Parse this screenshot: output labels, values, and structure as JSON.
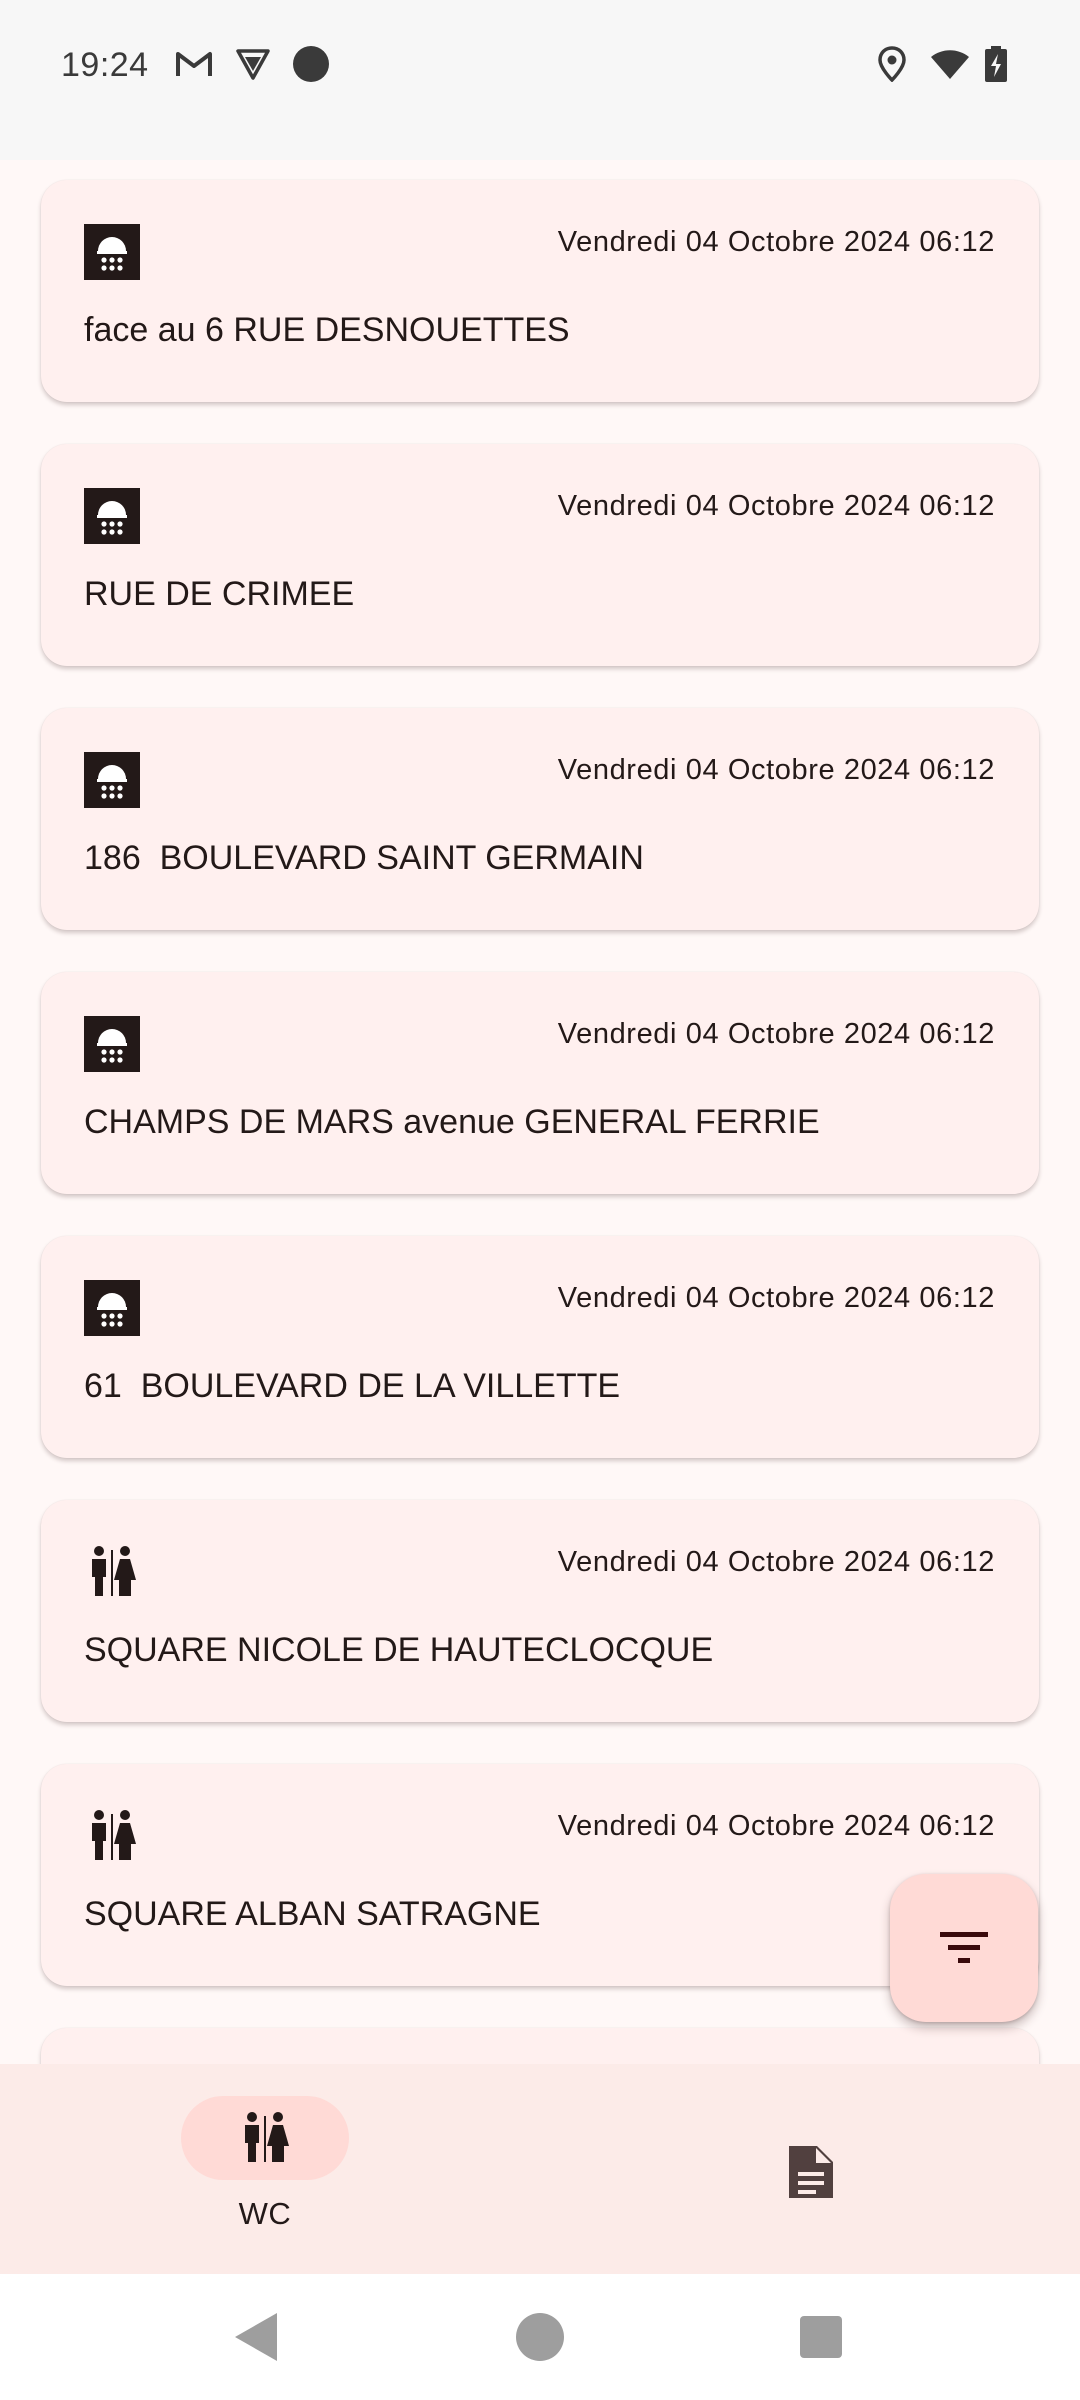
{
  "status_bar": {
    "time": "19:24",
    "left_icons": [
      "gmail-icon",
      "vpn-shield-icon",
      "record-dot-icon"
    ],
    "right_icons": [
      "location-icon",
      "wifi-icon",
      "battery-charging-icon"
    ]
  },
  "list": {
    "items": [
      {
        "type": "shower",
        "icon": "shower-icon",
        "date": "Vendredi 04 Octobre 2024 06:12",
        "address": "face au 6 RUE DESNOUETTES"
      },
      {
        "type": "shower",
        "icon": "shower-icon",
        "date": "Vendredi 04 Octobre 2024 06:12",
        "address": "RUE DE CRIMEE"
      },
      {
        "type": "shower",
        "icon": "shower-icon",
        "date": "Vendredi 04 Octobre 2024 06:12",
        "address": "186  BOULEVARD SAINT GERMAIN"
      },
      {
        "type": "shower",
        "icon": "shower-icon",
        "date": "Vendredi 04 Octobre 2024 06:12",
        "address": "CHAMPS DE MARS avenue GENERAL FERRIE"
      },
      {
        "type": "shower",
        "icon": "shower-icon",
        "date": "Vendredi 04 Octobre 2024 06:12",
        "address": "61  BOULEVARD DE LA VILLETTE"
      },
      {
        "type": "wc",
        "icon": "wc-icon",
        "date": "Vendredi 04 Octobre 2024 06:12",
        "address": "SQUARE NICOLE DE HAUTECLOCQUE"
      },
      {
        "type": "wc",
        "icon": "wc-icon",
        "date": "Vendredi 04 Octobre 2024 06:12",
        "address": "SQUARE ALBAN SATRAGNE"
      },
      {
        "type": "partial",
        "icon": "",
        "date": "",
        "address": ""
      }
    ]
  },
  "fab": {
    "icon": "filter-icon"
  },
  "bottom_nav": {
    "items": [
      {
        "label": "WC",
        "icon": "wc-icon",
        "selected": true
      },
      {
        "label": "",
        "icon": "document-icon",
        "selected": false
      }
    ]
  },
  "system_nav": {
    "buttons": [
      "back-icon",
      "home-icon",
      "recents-icon"
    ]
  },
  "colors": {
    "background": "#fff8f7",
    "card": "#fff0ef",
    "accent_container": "#ffdad6",
    "nav_background": "#fcebe8",
    "on_surface": "#231918"
  }
}
